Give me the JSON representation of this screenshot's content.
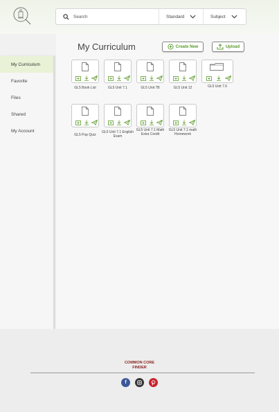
{
  "header": {
    "search_placeholder": "Search",
    "standard_label": "Standard",
    "subject_label": "Subject"
  },
  "sidebar": {
    "items": [
      {
        "label": "My Curriculum",
        "active": true
      },
      {
        "label": "Favorite",
        "active": false
      },
      {
        "label": "Files",
        "active": false
      },
      {
        "label": "Shared",
        "active": false
      },
      {
        "label": "My Account",
        "active": false
      }
    ]
  },
  "main": {
    "title": "My Curriculum",
    "create_label": "Create New",
    "upload_label": "Upload",
    "files": [
      {
        "name": "GL5 Book List",
        "kind": "document"
      },
      {
        "name": "GL5 Unit 7.1",
        "kind": "document"
      },
      {
        "name": "GL5 Unit 7B",
        "kind": "document"
      },
      {
        "name": "GL5 Unit 12",
        "kind": "document"
      },
      {
        "name": "GL5 Unit 7.6",
        "kind": "folder"
      },
      {
        "name": "GL5 Pop Quiz",
        "kind": "document"
      },
      {
        "name": "GL5 Unit 7.1 English Exam",
        "kind": "document"
      },
      {
        "name": "GL5 Unit 7.1 Math Extra Credit",
        "kind": "document"
      },
      {
        "name": "GL5 Unit 7.1 math Homework",
        "kind": "document"
      }
    ]
  },
  "footer": {
    "brand_line1": "COMMON CORE",
    "brand_line2": "FINDER",
    "social": [
      "facebook-icon",
      "instagram-icon",
      "pinterest-icon"
    ]
  },
  "colors": {
    "accent_green": "#5a9b2a",
    "active_nav": "#e9f2d6",
    "brand_red": "#8b2420"
  }
}
